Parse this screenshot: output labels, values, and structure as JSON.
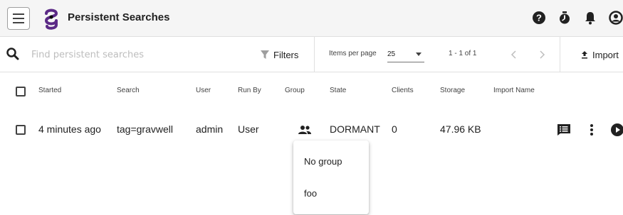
{
  "app": {
    "title": "Persistent Searches",
    "brand_color": "#5b2a86"
  },
  "topbar": {
    "menu_icon": "hamburger-menu-icon",
    "logo_icon": "gravwell-logo-icon",
    "icons": [
      "help-icon",
      "timer-icon",
      "notifications-bell-icon",
      "account-icon"
    ]
  },
  "toolbar": {
    "search_placeholder": "Find persistent searches",
    "filters_label": "Filters",
    "items_per_page_label": "Items per page",
    "items_per_page_value": "25",
    "range_text": "1 - 1 of 1",
    "import_label": "Import"
  },
  "table": {
    "headers": {
      "started": "Started",
      "search": "Search",
      "user": "User",
      "run_by": "Run By",
      "group": "Group",
      "state": "State",
      "clients": "Clients",
      "storage": "Storage",
      "import_name": "Import Name"
    },
    "rows": [
      {
        "started": "4 minutes ago",
        "search": "tag=gravwell",
        "user": "admin",
        "run_by": "User",
        "group_icon": "group-icon",
        "state": "DORMANT",
        "clients": "0",
        "storage": "47.96 KB",
        "import_name": "",
        "actions": [
          "view-results-icon",
          "more-vert-icon",
          "play-icon"
        ]
      }
    ]
  },
  "group_menu": {
    "items": [
      "No group",
      "foo"
    ]
  }
}
